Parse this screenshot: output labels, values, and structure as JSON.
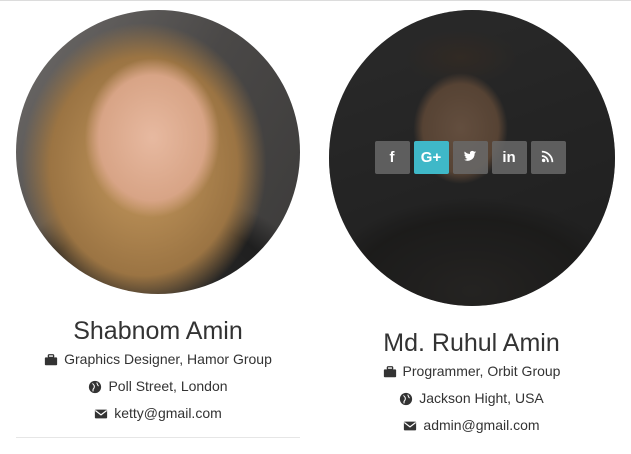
{
  "members": [
    {
      "name": "Shabnom Amin",
      "role": "Graphics Designer, Hamor Group",
      "location": "Poll Street, London",
      "email": "ketty@gmail.com"
    },
    {
      "name": "Md. Ruhul Amin",
      "role": "Programmer, Orbit Group",
      "location": "Jackson Hight, USA",
      "email": "admin@gmail.com",
      "socials": [
        {
          "label": "f",
          "icon": "facebook-icon"
        },
        {
          "label": "G+",
          "icon": "google-plus-icon"
        },
        {
          "label": "",
          "icon": "twitter-icon"
        },
        {
          "label": "in",
          "icon": "linkedin-icon"
        },
        {
          "label": "",
          "icon": "rss-icon"
        }
      ]
    }
  ],
  "colors": {
    "accent": "#3fb8c8",
    "social_bg": "#696969"
  }
}
